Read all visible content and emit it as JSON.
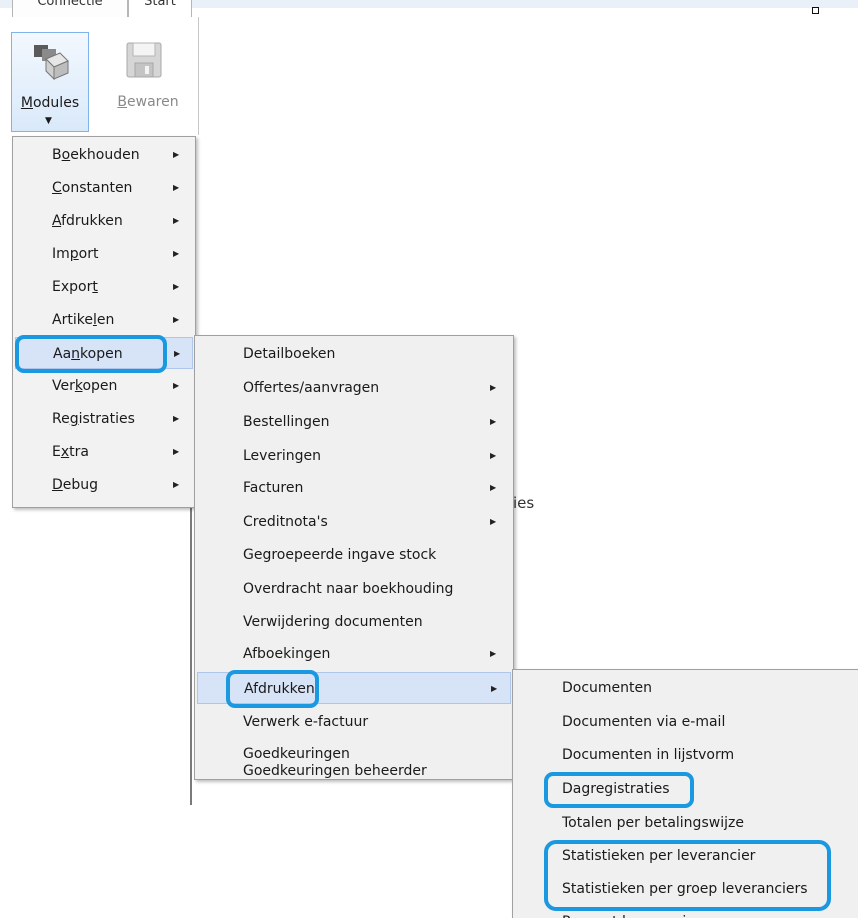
{
  "ribbon": {
    "tabs": [
      "Connectie",
      "Start"
    ],
    "modules_label": "Modules",
    "bewaren_label": "Bewaren"
  },
  "menu_modules": [
    {
      "label": "Boekhouden",
      "has_submenu": true
    },
    {
      "label": "Constanten",
      "has_submenu": true
    },
    {
      "label": "Afdrukken",
      "has_submenu": true
    },
    {
      "label": "Import",
      "has_submenu": true
    },
    {
      "label": "Export",
      "has_submenu": true
    },
    {
      "label": "Artikelen",
      "has_submenu": true
    },
    {
      "label": "Aankopen",
      "has_submenu": true,
      "selected": true
    },
    {
      "label": "Verkopen",
      "has_submenu": true
    },
    {
      "label": "Registraties",
      "has_submenu": true
    },
    {
      "label": "Extra",
      "has_submenu": true
    },
    {
      "label": "Debug",
      "has_submenu": true
    }
  ],
  "menu_aankopen": [
    {
      "label": "Detailboeken",
      "has_submenu": false
    },
    {
      "label": "Offertes/aanvragen",
      "has_submenu": true
    },
    {
      "label": "Bestellingen",
      "has_submenu": true
    },
    {
      "label": "Leveringen",
      "has_submenu": true
    },
    {
      "label": "Facturen",
      "has_submenu": true
    },
    {
      "label": "Creditnota's",
      "has_submenu": true
    },
    {
      "label": "Gegroepeerde ingave stock",
      "has_submenu": false
    },
    {
      "label": "Overdracht naar boekhouding",
      "has_submenu": false
    },
    {
      "label": "Verwijdering documenten",
      "has_submenu": false
    },
    {
      "label": "Afboekingen",
      "has_submenu": true
    },
    {
      "label": "Afdrukken",
      "has_submenu": true,
      "selected": true
    },
    {
      "label": "Verwerk e-factuur",
      "has_submenu": false
    },
    {
      "label": "Goedkeuringen",
      "has_submenu": false
    },
    {
      "label": "Goedkeuringen beheerder",
      "has_submenu": false
    }
  ],
  "menu_afdrukken": [
    {
      "label": "Documenten"
    },
    {
      "label": "Documenten via e-mail"
    },
    {
      "label": "Documenten in lijstvorm"
    },
    {
      "label": "Dagregistraties",
      "highlighted": true
    },
    {
      "label": "Totalen per betalingswijze"
    },
    {
      "label": "Statistieken per leverancier",
      "highlighted": true
    },
    {
      "label": "Statistieken per groep leveranciers",
      "highlighted": true
    },
    {
      "label": "Rapport leverancier"
    }
  ],
  "background": {
    "fragment_text": "ies"
  },
  "colors": {
    "highlight_outline": "#1a98e0",
    "menu_background": "#f0f0f0",
    "selected_item": "#d7e3f7"
  }
}
